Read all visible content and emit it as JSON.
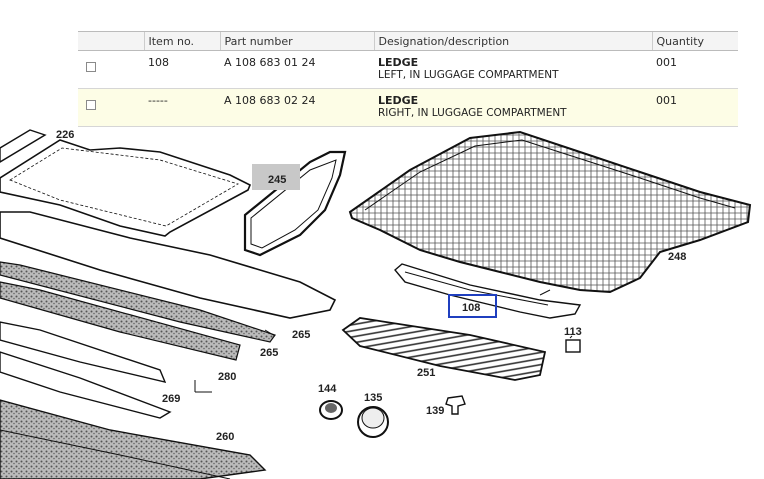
{
  "table": {
    "headers": [
      "",
      "Item no.",
      "Part number",
      "Designation/description",
      "Quantity"
    ],
    "rows": [
      {
        "item_no": "108",
        "part_number": "A 108 683 01 24",
        "designation": "LEDGE",
        "description": "LEFT, IN LUGGAGE COMPARTMENT",
        "quantity": "001"
      },
      {
        "item_no": "-----",
        "part_number": "A 108 683 02 24",
        "designation": "LEDGE",
        "description": "RIGHT, IN LUGGAGE COMPARTMENT",
        "quantity": "001"
      }
    ]
  },
  "diagram": {
    "labels": {
      "l226": "226",
      "l245": "245",
      "l248": "248",
      "l108": "108",
      "l113": "113",
      "l265a": "265",
      "l265b": "265",
      "l251": "251",
      "l280": "280",
      "l269": "269",
      "l144": "144",
      "l135": "135",
      "l139": "139",
      "l260": "260"
    },
    "highlight_color": "#1f3fbf"
  }
}
